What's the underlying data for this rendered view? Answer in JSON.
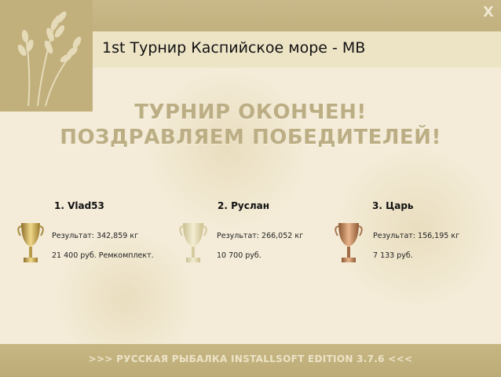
{
  "window": {
    "title": "1st Турнир Каспийское море - МВ",
    "close_label": "X"
  },
  "headline": {
    "line1": "ТУРНИР ОКОНЧЕН!",
    "line2": "ПОЗДРАВЛЯЕМ ПОБЕДИТЕЛЕЙ!"
  },
  "winners": [
    {
      "name": "1. Vlad53",
      "result": "Результат: 342,859 кг",
      "prize": "21 400 руб. Ремкомплект.",
      "cup": "gold-cup-icon"
    },
    {
      "name": "2. Руслан",
      "result": "Результат: 266,052 кг",
      "prize": "10 700 руб.",
      "cup": "silver-cup-icon"
    },
    {
      "name": "3. Царь",
      "result": "Результат: 156,195 кг",
      "prize": "7 133 руб.",
      "cup": "bronze-cup-icon"
    }
  ],
  "footer": {
    "text": ">>> РУССКАЯ РЫБАЛКА INSTALLSOFT EDITION 3.7.6 <<<"
  },
  "colors": {
    "background": "#f4ecd8",
    "bar": "#c2b17e",
    "gold": "#c9a640",
    "silver": "#d8cfa6",
    "bronze": "#b9835a"
  }
}
